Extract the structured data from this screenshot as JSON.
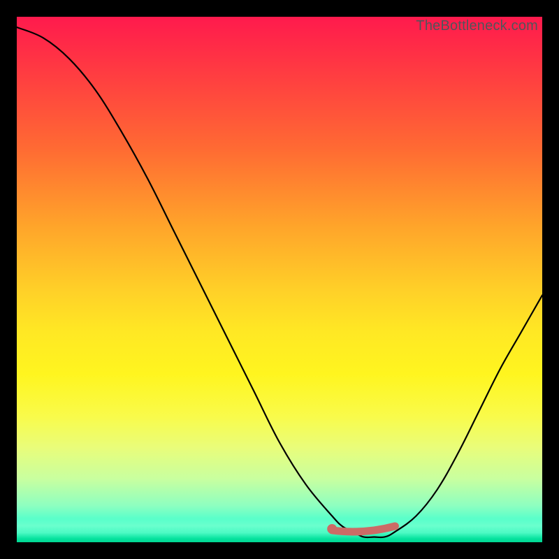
{
  "attribution": "TheBottleneck.com",
  "chart_data": {
    "type": "line",
    "title": "",
    "xlabel": "",
    "ylabel": "",
    "xlim": [
      0,
      100
    ],
    "ylim": [
      0,
      100
    ],
    "series": [
      {
        "name": "bottleneck-curve",
        "x": [
          0,
          5,
          10,
          15,
          20,
          25,
          30,
          35,
          40,
          45,
          50,
          55,
          60,
          62,
          64,
          66,
          68,
          70,
          72,
          76,
          80,
          84,
          88,
          92,
          96,
          100
        ],
        "y": [
          98,
          96,
          92,
          86,
          78,
          69,
          59,
          49,
          39,
          29,
          19,
          11,
          5,
          3,
          2,
          1,
          1,
          1,
          2,
          5,
          10,
          17,
          25,
          33,
          40,
          47
        ]
      }
    ],
    "highlight": {
      "name": "optimal-range",
      "x_start": 60,
      "x_end": 72,
      "y": 2
    },
    "background_gradient": {
      "top": "#ff1a4d",
      "mid": "#ffe824",
      "bottom": "#00d98f"
    }
  }
}
